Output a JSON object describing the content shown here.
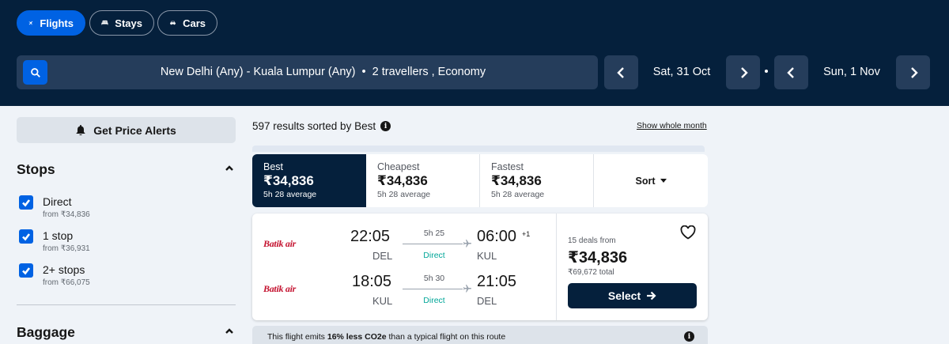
{
  "nav": {
    "tabs": [
      {
        "label": "Flights",
        "icon": "plane-icon",
        "active": true
      },
      {
        "label": "Stays",
        "icon": "bed-icon",
        "active": false
      },
      {
        "label": "Cars",
        "icon": "car-icon",
        "active": false
      }
    ]
  },
  "search": {
    "route": "New Delhi (Any) - Kuala Lumpur (Any)",
    "travellers": "2 travellers , Economy",
    "depart_date": "Sat, 31 Oct",
    "return_date": "Sun, 1 Nov"
  },
  "sidebar": {
    "price_alerts_label": "Get Price Alerts",
    "stops": {
      "title": "Stops",
      "options": [
        {
          "label": "Direct",
          "price": "from ₹34,836",
          "checked": true
        },
        {
          "label": "1 stop",
          "price": "from ₹36,931",
          "checked": true
        },
        {
          "label": "2+ stops",
          "price": "from ₹66,075",
          "checked": true
        }
      ]
    },
    "baggage": {
      "title": "Baggage"
    }
  },
  "results": {
    "count_text": "597 results sorted by Best",
    "whole_month_link": "Show whole month",
    "sort_tabs": [
      {
        "name": "Best",
        "price": "₹34,836",
        "avg": "5h 28 average",
        "active": true
      },
      {
        "name": "Cheapest",
        "price": "₹34,836",
        "avg": "5h 28 average",
        "active": false
      },
      {
        "name": "Fastest",
        "price": "₹34,836",
        "avg": "5h 28 average",
        "active": false
      }
    ],
    "sort_label": "Sort"
  },
  "card": {
    "legs": [
      {
        "airline": "Batik air",
        "depart_time": "22:05",
        "depart_code": "DEL",
        "duration": "5h 25",
        "stops": "Direct",
        "arrive_time": "06:00",
        "plus_day": "+1",
        "arrive_code": "KUL"
      },
      {
        "airline": "Batik air",
        "depart_time": "18:05",
        "depart_code": "KUL",
        "duration": "5h 30",
        "stops": "Direct",
        "arrive_time": "21:05",
        "plus_day": "",
        "arrive_code": "DEL"
      }
    ],
    "deals_text": "15 deals from",
    "price": "₹34,836",
    "total": "₹69,672 total",
    "select_label": "Select"
  },
  "eco": {
    "prefix": "This flight emits ",
    "highlight": "16% less CO2e",
    "suffix": " than a typical flight on this route"
  },
  "colors": {
    "header_bg": "#05203c",
    "accent_blue": "#0062e3",
    "direct_green": "#00a698",
    "airline_red": "#c4122f"
  }
}
